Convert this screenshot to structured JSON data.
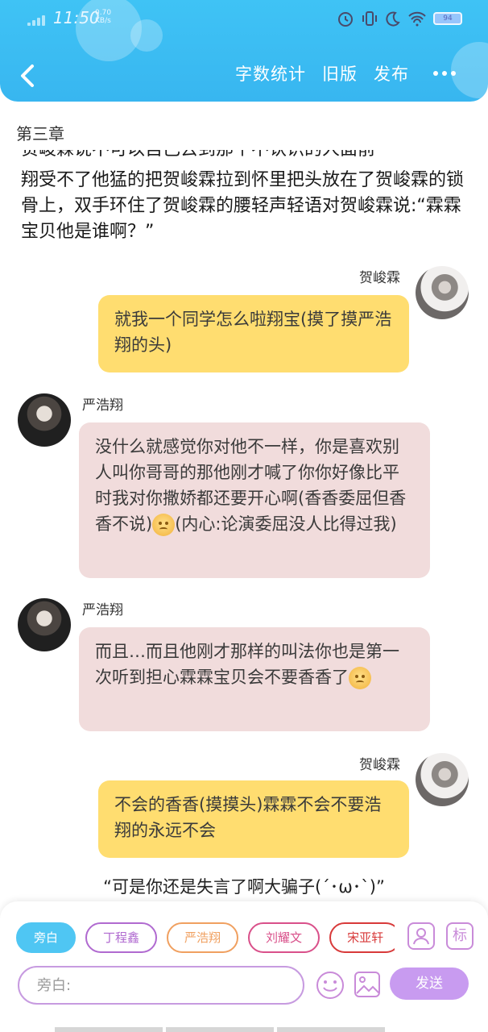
{
  "status_bar": {
    "time": "11:50",
    "speed_value": "0.70",
    "speed_unit": "KB/s",
    "battery": "94"
  },
  "header": {
    "actions": [
      "字数统计",
      "旧版",
      "发布"
    ]
  },
  "chapter_title": "第三章",
  "narration": {
    "cut_line": "贺峻霖说不可以自己去到那个不认识的人面前",
    "text": "翔受不了他猛的把贺峻霖拉到怀里把头放在了贺峻霖的锁骨上，双手环住了贺峻霖的腰轻声轻语对贺峻霖说:“霖霖宝贝他是谁啊？”"
  },
  "messages": [
    {
      "speaker": "贺峻霖",
      "side": "right",
      "text": "就我一个同学怎么啦翔宝(摸了摸严浩翔的头)"
    },
    {
      "speaker": "严浩翔",
      "side": "left",
      "text_before": "没什么就感觉你对他不一样，你是喜欢别人叫你哥哥的那他刚才喊了你你好像比平时我对你撒娇都还要开心啊(香香委屈但香香不说)",
      "text_after": "(内心:论演委屈没人比得过我)"
    },
    {
      "speaker": "严浩翔",
      "side": "left",
      "text_before": "而且…而且他刚才那样的叫法你也是第一次听到担心霖霖宝贝会不要香香了",
      "text_after": ""
    },
    {
      "speaker": "贺峻霖",
      "side": "right",
      "text": "不会的香香(摸摸头)霖霖不会不要浩翔的永远不会"
    }
  ],
  "closing_line": "“可是你还是失言了啊大骗子(´･ω･`)”",
  "input_panel": {
    "roles": [
      {
        "label": "旁白",
        "color": "#4fc6f3",
        "active": true
      },
      {
        "label": "丁程鑫",
        "color": "#b06ad0",
        "active": false
      },
      {
        "label": "严浩翔",
        "color": "#f0a060",
        "active": false
      },
      {
        "label": "刘耀文",
        "color": "#d9508a",
        "active": false
      },
      {
        "label": "宋亚轩",
        "color": "#d83a3a",
        "active": false
      }
    ],
    "tag_icon_label": "标",
    "input_placeholder": "旁白:",
    "send_label": "发送"
  }
}
